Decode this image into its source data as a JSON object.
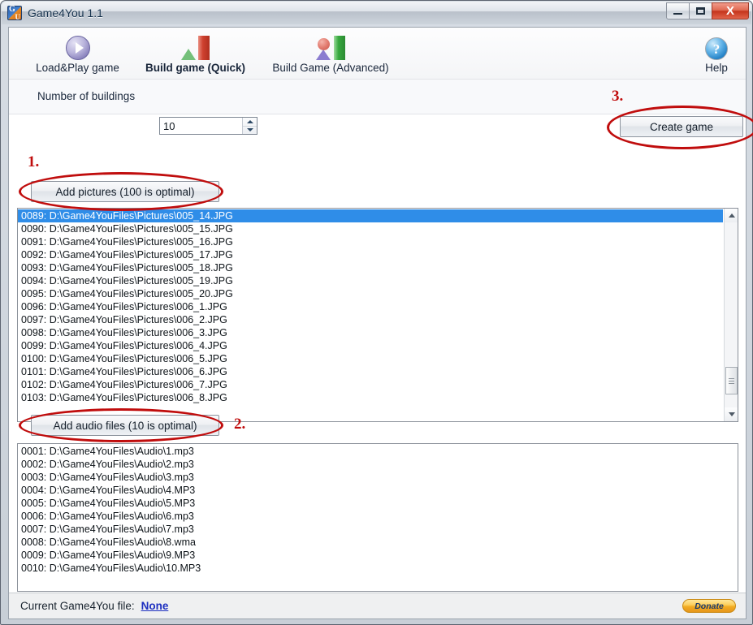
{
  "window": {
    "title": "Game4You 1.1",
    "app_icon": "app-logo-icon",
    "minimize_label": "Minimize",
    "maximize_label": "Maximize",
    "close_label": "X"
  },
  "toolbar": {
    "items": [
      {
        "label": "Load&Play game",
        "icon": "play-circle-icon",
        "active": false
      },
      {
        "label": "Build game (Quick)",
        "icon": "triangle-bar-icon",
        "active": true
      },
      {
        "label": "Build Game (Advanced)",
        "icon": "shapes-bar-icon",
        "active": false
      }
    ],
    "help_label": "Help",
    "help_icon": "help-question-icon"
  },
  "settings": {
    "buildings_label": "Number of buildings",
    "buildings_value": "10",
    "spinner_up_icon": "chevron-up-icon",
    "spinner_down_icon": "chevron-down-icon",
    "create_game_label": "Create game"
  },
  "pictures": {
    "add_button_label": "Add pictures (100 is optimal)",
    "selected_index": 0,
    "rows": [
      "0089:  D:\\Game4YouFiles\\Pictures\\005_14.JPG",
      "0090:  D:\\Game4YouFiles\\Pictures\\005_15.JPG",
      "0091:  D:\\Game4YouFiles\\Pictures\\005_16.JPG",
      "0092:  D:\\Game4YouFiles\\Pictures\\005_17.JPG",
      "0093:  D:\\Game4YouFiles\\Pictures\\005_18.JPG",
      "0094:  D:\\Game4YouFiles\\Pictures\\005_19.JPG",
      "0095:  D:\\Game4YouFiles\\Pictures\\005_20.JPG",
      "0096:  D:\\Game4YouFiles\\Pictures\\006_1.JPG",
      "0097:  D:\\Game4YouFiles\\Pictures\\006_2.JPG",
      "0098:  D:\\Game4YouFiles\\Pictures\\006_3.JPG",
      "0099:  D:\\Game4YouFiles\\Pictures\\006_4.JPG",
      "0100:  D:\\Game4YouFiles\\Pictures\\006_5.JPG",
      "0101:  D:\\Game4YouFiles\\Pictures\\006_6.JPG",
      "0102:  D:\\Game4YouFiles\\Pictures\\006_7.JPG",
      "0103:  D:\\Game4YouFiles\\Pictures\\006_8.JPG"
    ]
  },
  "audio": {
    "add_button_label": "Add audio files (10 is optimal)",
    "rows": [
      "0001:  D:\\Game4YouFiles\\Audio\\1.mp3",
      "0002:  D:\\Game4YouFiles\\Audio\\2.mp3",
      "0003:  D:\\Game4YouFiles\\Audio\\3.mp3",
      "0004:  D:\\Game4YouFiles\\Audio\\4.MP3",
      "0005:  D:\\Game4YouFiles\\Audio\\5.MP3",
      "0006:  D:\\Game4YouFiles\\Audio\\6.mp3",
      "0007:  D:\\Game4YouFiles\\Audio\\7.mp3",
      "0008:  D:\\Game4YouFiles\\Audio\\8.wma",
      "0009:  D:\\Game4YouFiles\\Audio\\9.MP3",
      "0010:  D:\\Game4YouFiles\\Audio\\10.MP3"
    ]
  },
  "statusbar": {
    "label": "Current Game4You file:",
    "file": "None",
    "donate_label": "Donate"
  },
  "annotations": {
    "step1": "1.",
    "step2": "2.",
    "step3": "3.",
    "color": "#c00d0d"
  }
}
